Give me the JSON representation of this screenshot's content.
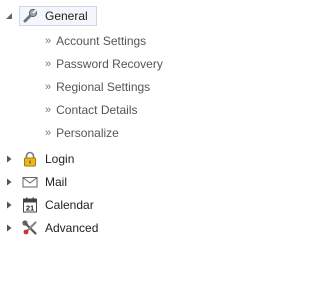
{
  "tree": {
    "general": {
      "label": "General",
      "icon": "wrench-icon",
      "expanded": true,
      "selected": true,
      "children": [
        {
          "label": "Account Settings"
        },
        {
          "label": "Password Recovery"
        },
        {
          "label": "Regional Settings"
        },
        {
          "label": "Contact Details"
        },
        {
          "label": "Personalize"
        }
      ]
    },
    "login": {
      "label": "Login",
      "icon": "lock-icon",
      "expanded": false
    },
    "mail": {
      "label": "Mail",
      "icon": "envelope-icon",
      "expanded": false
    },
    "calendar": {
      "label": "Calendar",
      "icon": "calendar-icon",
      "date_number": "21",
      "expanded": false
    },
    "advanced": {
      "label": "Advanced",
      "icon": "tools-icon",
      "expanded": false
    }
  },
  "colors": {
    "selected_border": "#c9d7e8",
    "selected_background": "#f3f7fb",
    "lock_body": "#e8b820",
    "text": "#222222"
  }
}
